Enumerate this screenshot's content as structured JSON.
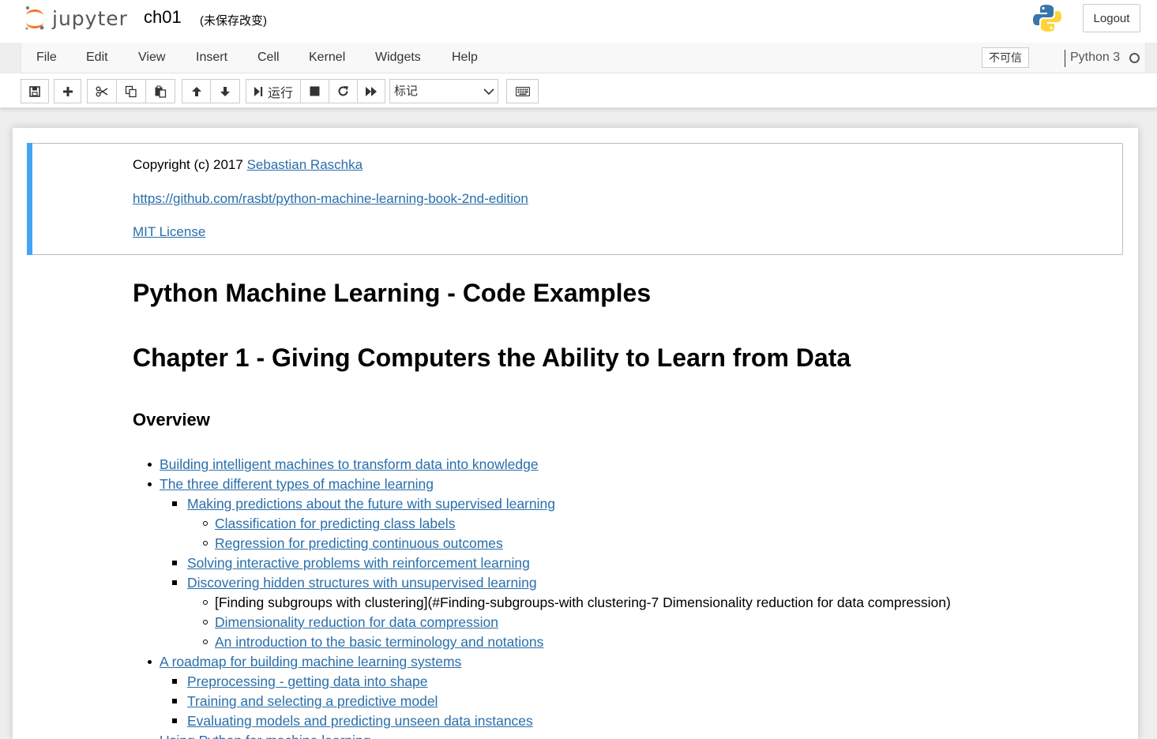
{
  "header": {
    "logo_text": "jupyter",
    "notebook_name": "ch01",
    "save_status": "(未保存改变)",
    "logout_label": "Logout"
  },
  "menubar": {
    "items": [
      "File",
      "Edit",
      "View",
      "Insert",
      "Cell",
      "Kernel",
      "Widgets",
      "Help"
    ],
    "trust_label": "不可信",
    "kernel_name": "Python 3"
  },
  "toolbar": {
    "run_label": "运行",
    "cell_type": "标记",
    "buttons": [
      "save-icon",
      "plus-icon",
      "scissors-icon",
      "copy-icon",
      "paste-icon",
      "arrow-up-icon",
      "arrow-down-icon",
      "run-icon",
      "stop-icon",
      "restart-icon",
      "fast-forward-icon",
      "keyboard-icon"
    ]
  },
  "cell1": {
    "copyright_prefix": "Copyright (c) 2017 ",
    "author_link": "Sebastian Raschka",
    "repo_link": "https://github.com/rasbt/python-machine-learning-book-2nd-edition",
    "license_link": "MIT License"
  },
  "cell2": {
    "title": "Python Machine Learning - Code Examples",
    "chapter": "Chapter 1 - Giving Computers the Ability to Learn from Data",
    "overview": "Overview",
    "toc": [
      {
        "level": 1,
        "text": "Building intelligent machines to transform data into knowledge",
        "link": true
      },
      {
        "level": 1,
        "text": "The three different types of machine learning",
        "link": true
      },
      {
        "level": 2,
        "text": "Making predictions about the future with supervised learning",
        "link": true
      },
      {
        "level": 3,
        "text": "Classification for predicting class labels",
        "link": true
      },
      {
        "level": 3,
        "text": "Regression for predicting continuous outcomes",
        "link": true
      },
      {
        "level": 2,
        "text": "Solving interactive problems with reinforcement learning",
        "link": true
      },
      {
        "level": 2,
        "text": "Discovering hidden structures with unsupervised learning",
        "link": true
      },
      {
        "level": 3,
        "text": "[Finding subgroups with clustering](#Finding-subgroups-with clustering-7 Dimensionality reduction for data compression)",
        "link": false
      },
      {
        "level": 3,
        "text": "Dimensionality reduction for data compression",
        "link": true
      },
      {
        "level": 3,
        "text": "An introduction to the basic terminology and notations",
        "link": true
      },
      {
        "level": 1,
        "text": "A roadmap for building machine learning systems",
        "link": true
      },
      {
        "level": 2,
        "text": "Preprocessing - getting data into shape",
        "link": true
      },
      {
        "level": 2,
        "text": "Training and selecting a predictive model",
        "link": true
      },
      {
        "level": 2,
        "text": "Evaluating models and predicting unseen data instances",
        "link": true
      },
      {
        "level": 1,
        "text": "Using Python for machine learning",
        "link": true
      }
    ]
  },
  "colors": {
    "link": "#296eaa",
    "selected_cell_bar": "#42a5f5",
    "logo_orange": "#f37726"
  }
}
